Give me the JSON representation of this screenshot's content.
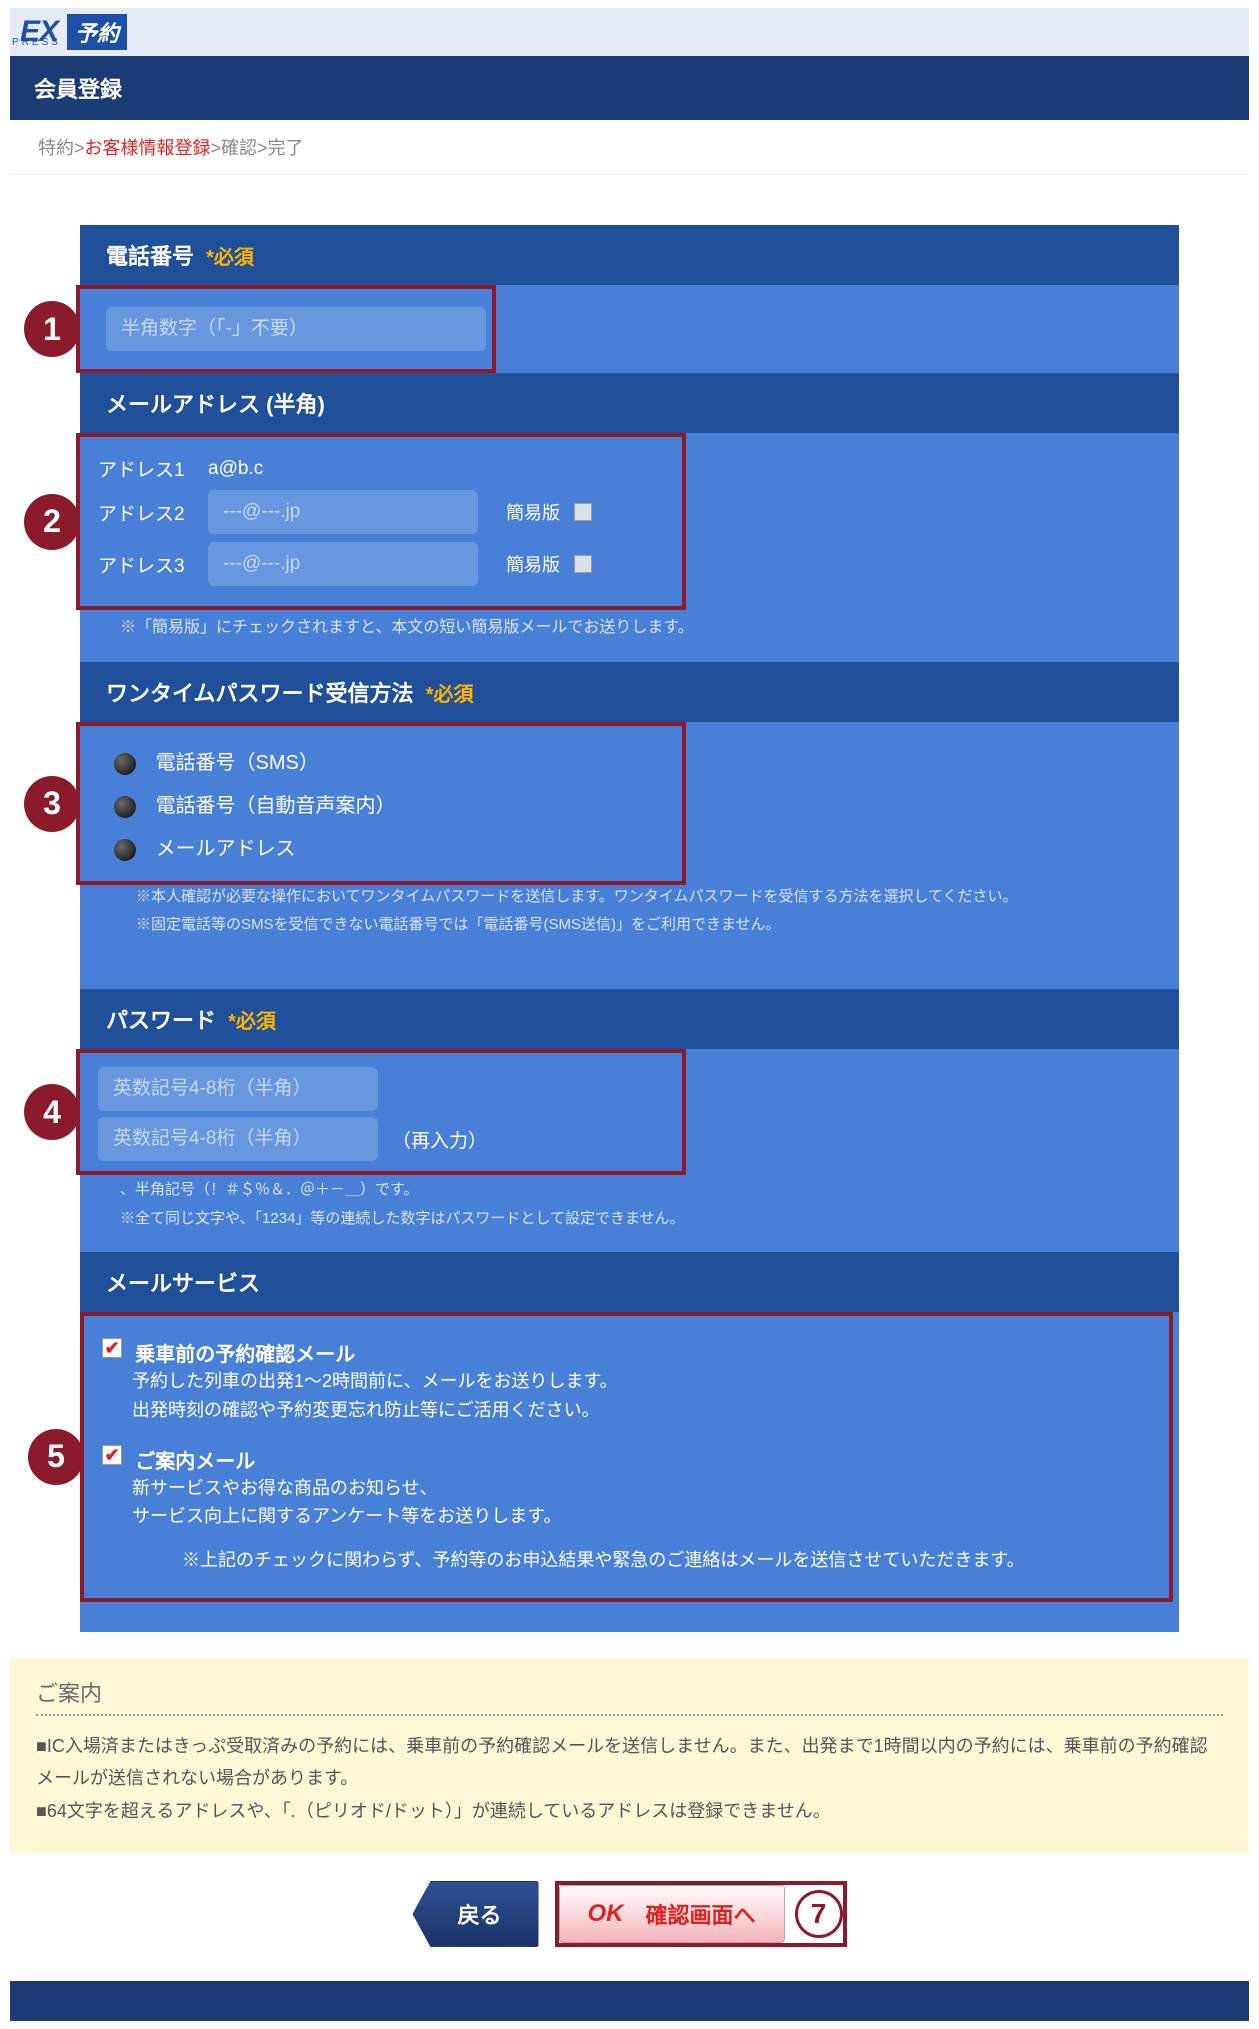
{
  "header": {
    "logo_ex": "EX",
    "logo_press": "PRESS",
    "logo_yoyaku": "予約",
    "page_title": "会員登録"
  },
  "breadcrumb": {
    "step1": "特約",
    "sep": ">",
    "step2": "お客様情報登録",
    "step3": "確認",
    "step4": "完了"
  },
  "annotations": {
    "n1": "1",
    "n2": "2",
    "n3": "3",
    "n4": "4",
    "n5": "5",
    "n7": "7"
  },
  "phone": {
    "header": "電話番号",
    "required": "*必須",
    "placeholder": "半角数字（「-」不要）"
  },
  "email": {
    "header": "メールアドレス (半角)",
    "addr1_label": "アドレス1",
    "addr1_value": "a@b.c",
    "addr2_label": "アドレス2",
    "addr3_label": "アドレス3",
    "placeholder": "---@---.jp",
    "simple_label": "簡易版",
    "note": "※「簡易版」にチェックされますと、本文の短い簡易版メールでお送りします。"
  },
  "otp": {
    "header": "ワンタイムパスワード受信方法",
    "required": "*必須",
    "opt_sms": "電話番号（SMS）",
    "opt_auto": "電話番号（自動音声案内）",
    "opt_mail": "メールアドレス",
    "note1": "※本人確認が必要な操作においてワンタイムパスワードを送信します。ワンタイムパスワードを受信する方法を選択してください。",
    "note2": "※固定電話等のSMSを受信できない電話番号では「電話番号(SMS送信)」をご利用できません。"
  },
  "password": {
    "header": "パスワード",
    "required": "*必須",
    "placeholder": "英数記号4-8桁（半角）",
    "reenter": "（再入力）",
    "note1_tail": "、半角記号（！＃＄％＆．＠＋－＿）です。",
    "note2": "※全て同じ文字や、「1234」等の連続した数字はパスワードとして設定できません。"
  },
  "mailservice": {
    "header": "メールサービス",
    "item1_title": "乗車前の予約確認メール",
    "item1_line1": "予約した列車の出発1〜2時間前に、メールをお送りします。",
    "item1_line2": "出発時刻の確認や予約変更忘れ防止等にご活用ください。",
    "item2_title": "ご案内メール",
    "item2_line1": "新サービスやお得な商品のお知らせ、",
    "item2_line2": "サービス向上に関するアンケート等をお送りします。",
    "note": "※上記のチェックに関わらず、予約等のお申込結果や緊急のご連絡はメールを送信させていただきます。"
  },
  "guide": {
    "title": "ご案内",
    "line1": "■IC入場済またはきっぷ受取済みの予約には、乗車前の予約確認メールを送信しません。また、出発まで1時間以内の予約には、乗車前の予約確認メールが送信されない場合があります。",
    "line2": "■64文字を超えるアドレスや、「.（ピリオド/ドット）」が連続しているアドレスは登録できません。"
  },
  "buttons": {
    "back": "戻る",
    "ok_word": "OK",
    "ok_kana": "確認画面へ"
  }
}
